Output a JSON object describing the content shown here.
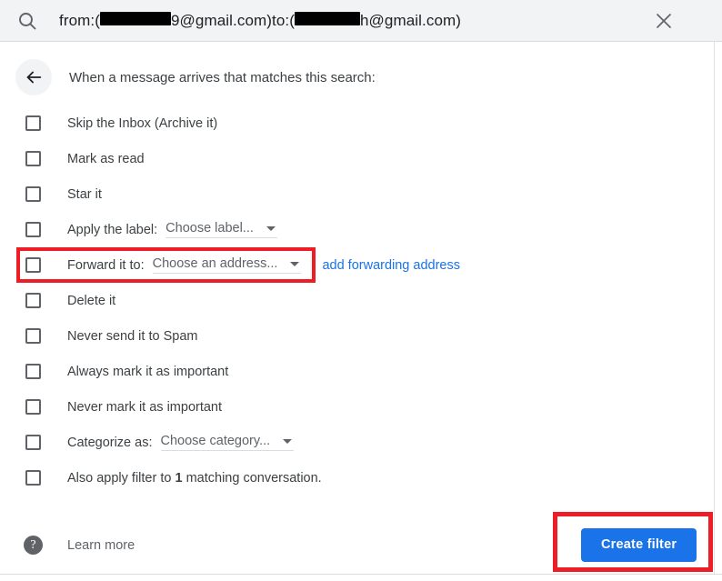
{
  "search": {
    "icon": "search-icon",
    "prefix_from": "from:(",
    "redacted_1": "",
    "mid_from": "9@gmail.com)",
    "prefix_to": " to:(",
    "redacted_2": "",
    "mid_to": "h@gmail.com)",
    "close_icon": "close-icon"
  },
  "header": {
    "back_icon": "arrow-back-icon",
    "title": "When a message arrives that matches this search:"
  },
  "options": [
    {
      "id": "skip-inbox",
      "label": "Skip the Inbox (Archive it)",
      "checked": false
    },
    {
      "id": "mark-as-read",
      "label": "Mark as read",
      "checked": false
    },
    {
      "id": "star-it",
      "label": "Star it",
      "checked": false
    },
    {
      "id": "apply-label",
      "label": "Apply the label:",
      "checked": false,
      "dropdown": "Choose label..."
    },
    {
      "id": "forward-it",
      "label": "Forward it to:",
      "checked": false,
      "dropdown": "Choose an address...",
      "link": "add forwarding address",
      "highlighted": true
    },
    {
      "id": "delete-it",
      "label": "Delete it",
      "checked": false
    },
    {
      "id": "never-spam",
      "label": "Never send it to Spam",
      "checked": false
    },
    {
      "id": "always-important",
      "label": "Always mark it as important",
      "checked": false
    },
    {
      "id": "never-important",
      "label": "Never mark it as important",
      "checked": false
    },
    {
      "id": "categorize-as",
      "label": "Categorize as:",
      "checked": false,
      "dropdown": "Choose category..."
    },
    {
      "id": "also-apply",
      "label_pre": "Also apply filter to ",
      "label_bold": "1",
      "label_post": " matching conversation.",
      "checked": false
    }
  ],
  "footer": {
    "help_icon": "help-icon",
    "help_glyph": "?",
    "learn_more": "Learn more",
    "create_button": "Create filter"
  },
  "colors": {
    "accent_blue": "#1a73e8",
    "highlight_red": "#ee1c25",
    "searchbar_bg": "#f1f3f4",
    "text_primary": "#3c4043",
    "text_secondary": "#5f6368"
  }
}
